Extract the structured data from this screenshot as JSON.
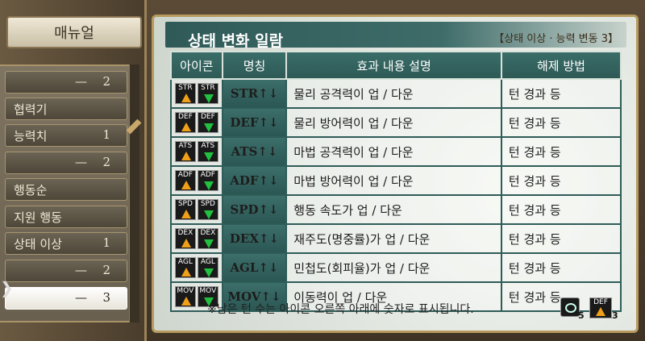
{
  "menu": {
    "title": "매뉴얼",
    "items": [
      {
        "label": "",
        "dash": "—",
        "num": "2"
      },
      {
        "label": "협력기",
        "dash": "",
        "num": ""
      },
      {
        "label": "능력치",
        "dash": "",
        "num": "1"
      },
      {
        "label": "",
        "dash": "—",
        "num": "2"
      },
      {
        "label": "행동순",
        "dash": "",
        "num": ""
      },
      {
        "label": "지원 행동",
        "dash": "",
        "num": ""
      },
      {
        "label": "상태 이상",
        "dash": "",
        "num": "1"
      },
      {
        "label": "",
        "dash": "—",
        "num": "2"
      },
      {
        "label": "",
        "dash": "—",
        "num": "3"
      }
    ]
  },
  "main": {
    "title": "상태 변화 일람",
    "subtitle": "【상태 이상 · 능력 변동 3】",
    "headers": [
      "아이콘",
      "명칭",
      "효과 내용 설명",
      "해제 방법"
    ],
    "rows": [
      {
        "abbr": "STR",
        "name": "STR↑↓",
        "desc": "물리 공격력이 업 / 다운",
        "release": "턴 경과 등"
      },
      {
        "abbr": "DEF",
        "name": "DEF↑↓",
        "desc": "물리 방어력이 업 / 다운",
        "release": "턴 경과 등"
      },
      {
        "abbr": "ATS",
        "name": "ATS↑↓",
        "desc": "마법 공격력이 업 / 다운",
        "release": "턴 경과 등"
      },
      {
        "abbr": "ADF",
        "name": "ADF↑↓",
        "desc": "마법 방어력이 업 / 다운",
        "release": "턴 경과 등"
      },
      {
        "abbr": "SPD",
        "name": "SPD↑↓",
        "desc": "행동 속도가 업 / 다운",
        "release": "턴 경과 등"
      },
      {
        "abbr": "DEX",
        "name": "DEX↑↓",
        "desc": "재주도(명중률)가 업 / 다운",
        "release": "턴 경과 등"
      },
      {
        "abbr": "AGL",
        "name": "AGL↑↓",
        "desc": "민첩도(회피율)가 업 / 다운",
        "release": "턴 경과 등"
      },
      {
        "abbr": "MOV",
        "name": "MOV↑↓",
        "desc": "이동력이 업 / 다운",
        "release": "턴 경과 등"
      }
    ],
    "note": "※남은 턴 수는 아이콘 오른쪽 아래에 숫자로 표시됩니다.",
    "legend": {
      "eye_count": "5",
      "def_label": "DEF",
      "def_count": "3"
    }
  },
  "colors": {
    "buff_arrow": "#f0a018",
    "debuff_arrow": "#22c040",
    "header_teal": "#2e5a56"
  }
}
